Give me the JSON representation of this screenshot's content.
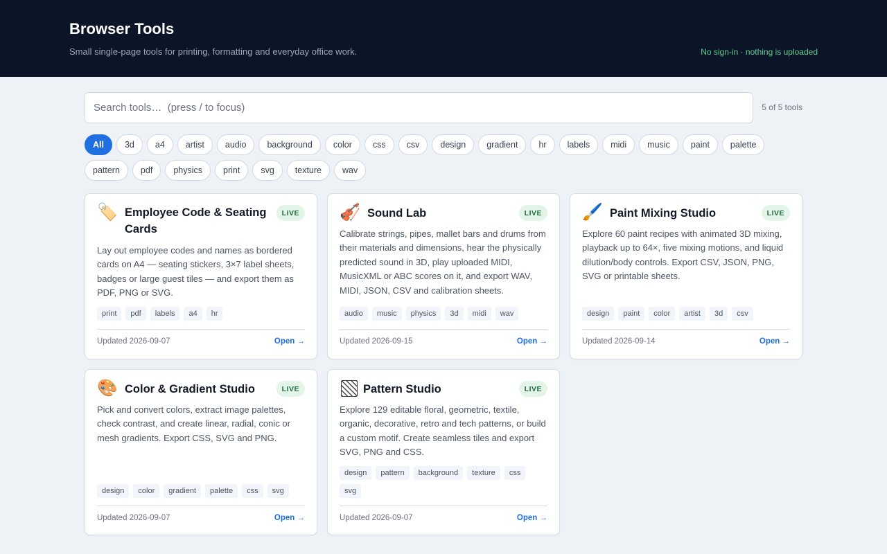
{
  "header": {
    "title": "Browser Tools",
    "subtitle": "Small single-page tools for printing, formatting and everyday office work.",
    "notice": "No sign-in · nothing is uploaded"
  },
  "search": {
    "placeholder": "Search tools…  (press / to focus)",
    "count": "5 of 5 tools"
  },
  "filters": [
    "All",
    "3d",
    "a4",
    "artist",
    "audio",
    "background",
    "color",
    "css",
    "csv",
    "design",
    "gradient",
    "hr",
    "labels",
    "midi",
    "music",
    "paint",
    "palette",
    "pattern",
    "pdf",
    "physics",
    "print",
    "svg",
    "texture",
    "wav"
  ],
  "active_filter": "All",
  "colors": {
    "accent": "#1f6fe0",
    "header_bg": "#0c1527",
    "live_bg": "#e3f4e8",
    "live_text": "#1d6b3a",
    "notice": "#5fcf8f"
  },
  "cards": [
    {
      "icon": "🏷️",
      "icon_name": "label-tag-icon",
      "name": "Employee Code & Seating Cards",
      "badge": "LIVE",
      "description": "Lay out employee codes and names as bordered cards on A4 — seating stickers, 3×7 label sheets, badges or large guest tiles — and export them as PDF, PNG or SVG.",
      "tags": [
        "print",
        "pdf",
        "labels",
        "a4",
        "hr"
      ],
      "updated": "Updated 2026-09-07",
      "open": "Open →"
    },
    {
      "icon": "🎻",
      "icon_name": "violin-icon",
      "name": "Sound Lab",
      "badge": "LIVE",
      "description": "Calibrate strings, pipes, mallet bars and drums from their materials and dimensions, hear the physically predicted sound in 3D, play uploaded MIDI, MusicXML or ABC scores on it, and export WAV, MIDI, JSON, CSV and calibration sheets.",
      "tags": [
        "audio",
        "music",
        "physics",
        "3d",
        "midi",
        "wav"
      ],
      "updated": "Updated 2026-09-15",
      "open": "Open →"
    },
    {
      "icon": "🖌️",
      "icon_name": "paintbrush-icon",
      "name": "Paint Mixing Studio",
      "badge": "LIVE",
      "description": "Explore 60 paint recipes with animated 3D mixing, playback up to 64×, five mixing motions, and liquid dilution/body controls. Export CSV, JSON, PNG, SVG or printable sheets.",
      "tags": [
        "design",
        "paint",
        "color",
        "artist",
        "3d",
        "csv"
      ],
      "updated": "Updated 2026-09-14",
      "open": "Open →"
    },
    {
      "icon": "🎨",
      "icon_name": "palette-icon",
      "name": "Color & Gradient Studio",
      "badge": "LIVE",
      "description": "Pick and convert colors, extract image palettes, check contrast, and create linear, radial, conic or mesh gradients. Export CSS, SVG and PNG.",
      "tags": [
        "design",
        "color",
        "gradient",
        "palette",
        "css",
        "svg"
      ],
      "updated": "Updated 2026-09-07",
      "open": "Open →"
    },
    {
      "icon": "",
      "icon_name": "hatch-pattern-icon",
      "name": "Pattern Studio",
      "badge": "LIVE",
      "description": "Explore 129 editable floral, geometric, textile, organic, decorative, retro and tech patterns, or build a custom motif. Create seamless tiles and export SVG, PNG and CSS.",
      "tags": [
        "design",
        "pattern",
        "background",
        "texture",
        "css",
        "svg"
      ],
      "updated": "Updated 2026-09-07",
      "open": "Open →"
    }
  ]
}
